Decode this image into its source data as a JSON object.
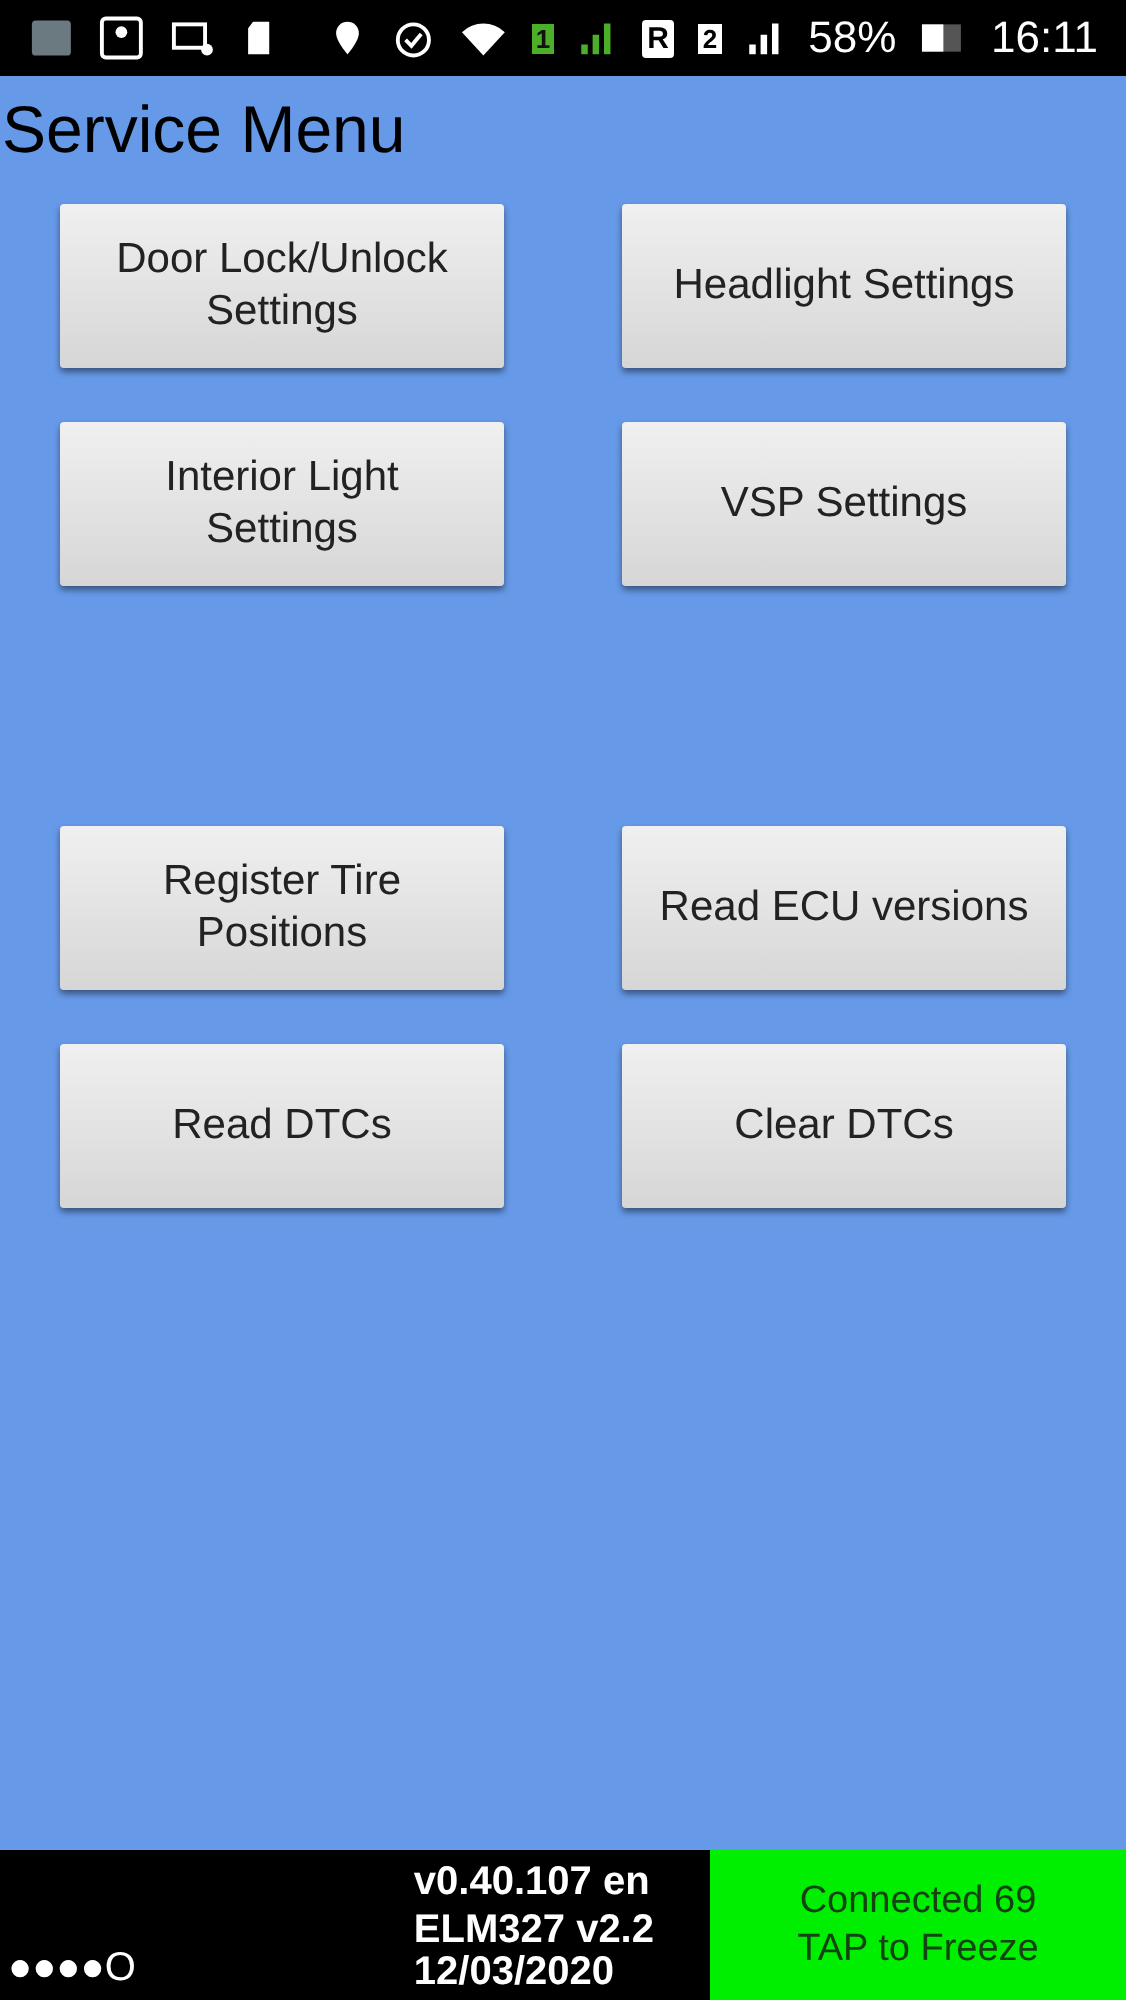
{
  "status_bar": {
    "sim1": "1",
    "roaming": "R",
    "sim2": "2",
    "battery": "58%",
    "time": "16:11"
  },
  "title": "Service Menu",
  "button_groups": [
    [
      "Door Lock/Unlock Settings",
      "Headlight Settings",
      "Interior Light Settings",
      "VSP Settings"
    ],
    [
      "Register Tire Positions",
      "Read ECU versions",
      "Read DTCs",
      "Clear DTCs"
    ]
  ],
  "footer": {
    "dots": "●●●●O",
    "version": "v0.40.107 en",
    "adapter": "ELM327 v2.2",
    "date": "12/03/2020",
    "connection": "Connected 69",
    "action": "TAP to Freeze"
  }
}
